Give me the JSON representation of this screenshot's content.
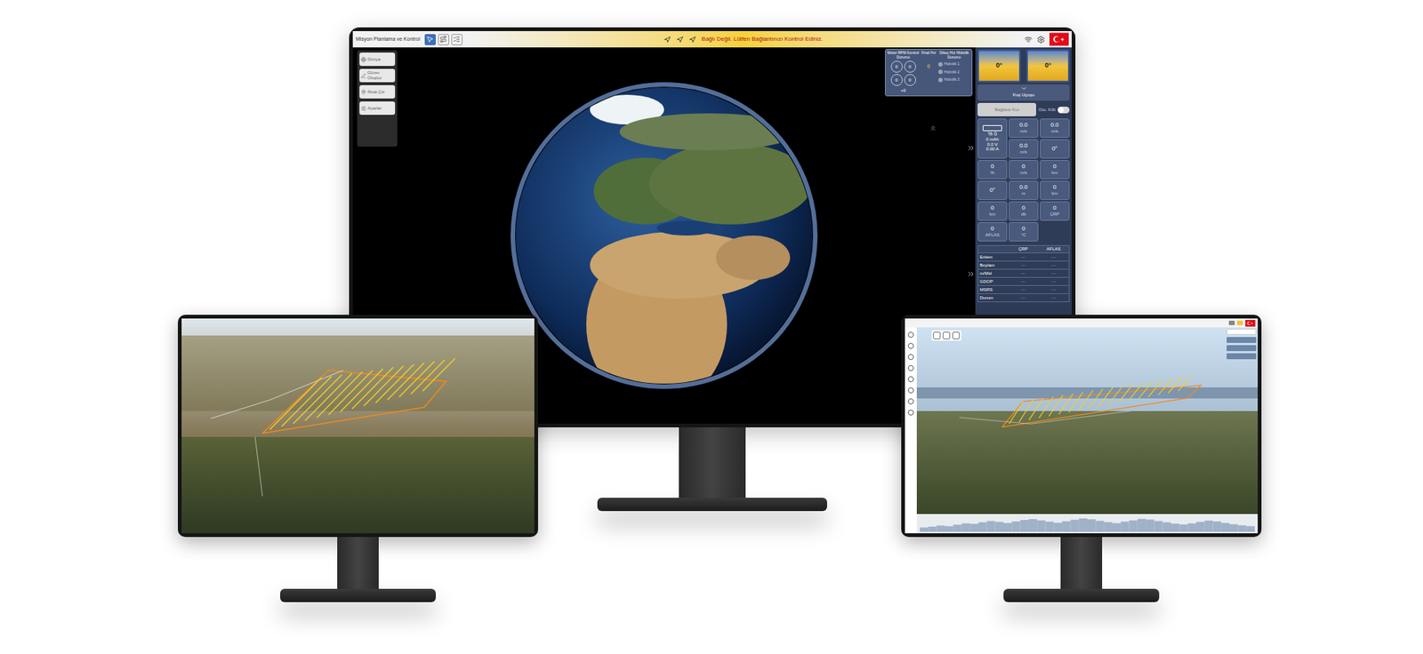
{
  "main_window": {
    "title": "Misyon Planlama ve Kontrol",
    "status_banner": "Bağlı Değil. Lütfen Bağlantınızı Kontrol Ediniz.",
    "toolbar": [
      {
        "selected": true
      },
      {
        "selected": false
      },
      {
        "selected": false
      }
    ],
    "menu": [
      {
        "label": "Dünya"
      },
      {
        "label": "Görev Oluştur"
      },
      {
        "label": "Rota Çiz"
      },
      {
        "label": "Ayarlar"
      }
    ],
    "gauges": {
      "title": "Motor RPM Kontrol Durumu",
      "speed_title": "Final Hız",
      "speed_value": "0",
      "hydraulic_title": "Dikey Hız Hidrolik Durumu",
      "hydraulic_items": [
        "Hidrolik 1",
        "Hidrolik 2",
        "Hidrolik 3"
      ],
      "rpm_values": [
        "0",
        "0",
        "0",
        "0"
      ],
      "bottom_value": "+0"
    },
    "attitude": [
      "0°",
      "0°"
    ],
    "mode_button": "Kuş Uçuşu",
    "connect_button": {
      "label": "Bağlantı Kur",
      "disabled": true
    },
    "toggle": {
      "label": "Oto. Kilit",
      "on": false
    },
    "battery": {
      "percent": "% 0",
      "capacity": "0 mAh",
      "voltage": "0.0 V",
      "current": "0.00 A",
      "level": 0
    },
    "telemetry": [
      {
        "value": "0.0",
        "unit": "m/s"
      },
      {
        "value": "0.0",
        "unit": "m/s"
      },
      {
        "value": "0.0",
        "unit": "m/s"
      },
      {
        "value": "0°",
        "unit": ""
      },
      {
        "value": "0",
        "unit": "%"
      },
      {
        "value": "0",
        "unit": "m/s"
      },
      {
        "value": "0",
        "unit": "km"
      },
      {
        "value": "0°",
        "unit": ""
      },
      {
        "value": "0.0",
        "unit": "m"
      },
      {
        "value": "0",
        "unit": "km"
      },
      {
        "value": "0",
        "unit": "km"
      },
      {
        "value": "0",
        "unit": "dk"
      },
      {
        "value": "0",
        "unit": "ÇRP"
      },
      {
        "value": "0",
        "unit": "AFLAS"
      },
      {
        "value": "0",
        "unit": "°C"
      }
    ],
    "table": {
      "columns": [
        "ÇRP",
        "AFLAS"
      ],
      "rows": [
        {
          "label": "Enlem",
          "values": [
            "---",
            "---"
          ]
        },
        {
          "label": "Boylam",
          "values": [
            "---",
            "---"
          ]
        },
        {
          "label": "m/Msl",
          "values": [
            "---",
            "---"
          ]
        },
        {
          "label": "GDOP",
          "values": [
            "---",
            "---"
          ]
        },
        {
          "label": "MSRS",
          "values": [
            "---",
            "---"
          ]
        },
        {
          "label": "Durum",
          "values": [
            "---",
            "---"
          ]
        }
      ]
    }
  },
  "right_window": {
    "elevation_profile": [
      820,
      860,
      910,
      880,
      950,
      1010,
      990,
      1060,
      1120,
      1080,
      1030,
      1100,
      1170,
      1210,
      1150,
      1090,
      1040,
      1110,
      1180,
      1240,
      1200,
      1130,
      1070,
      1020,
      1090,
      1150,
      1220,
      1190,
      1120,
      1060,
      1000,
      960,
      1010,
      1080,
      1140,
      1100,
      1030,
      970,
      920,
      880
    ]
  }
}
